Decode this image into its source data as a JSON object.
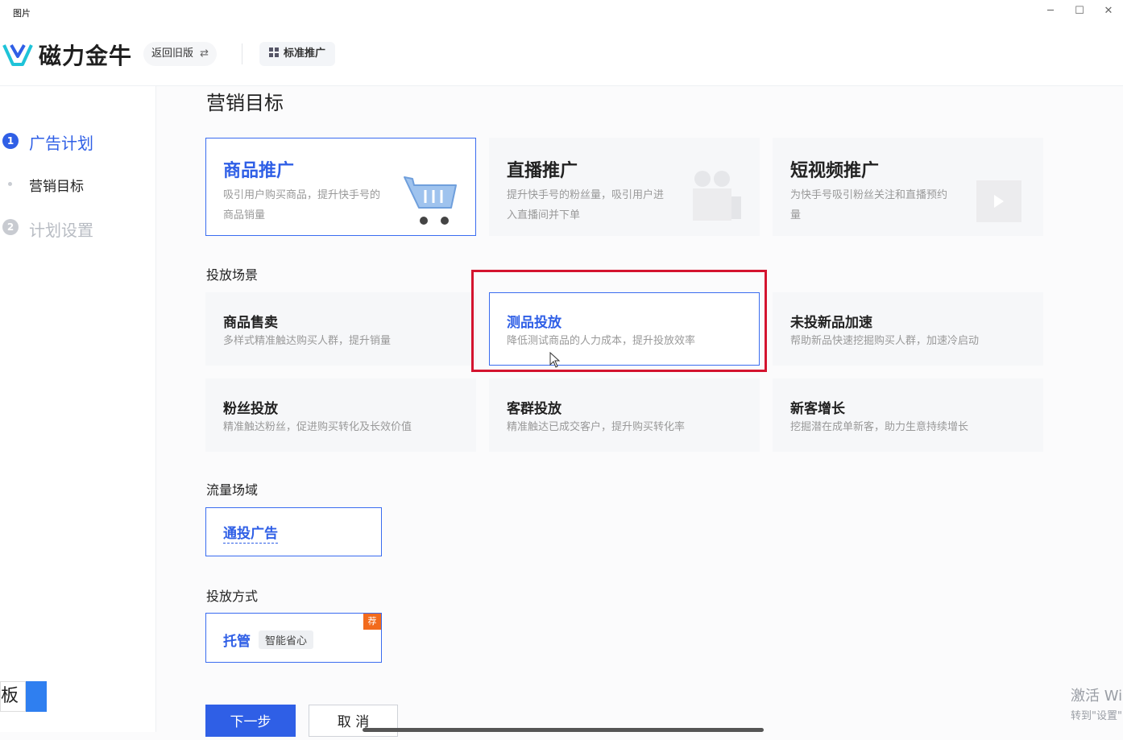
{
  "window": {
    "title": "图片"
  },
  "header": {
    "logo_text": "磁力金牛",
    "old_version": "返回旧版",
    "old_version_arrow": "⇄",
    "mode": "标准推广"
  },
  "sidebar": {
    "steps": [
      {
        "num": "1",
        "label": "广告计划"
      },
      {
        "label": "营销目标"
      },
      {
        "num": "2",
        "label": "计划设置"
      }
    ]
  },
  "page_title": "营销目标",
  "goals": [
    {
      "title": "商品推广",
      "desc": "吸引用户购买商品，提升快手号的商品销量"
    },
    {
      "title": "直播推广",
      "desc": "提升快手号的粉丝量，吸引用户进入直播间并下单"
    },
    {
      "title": "短视频推广",
      "desc": "为快手号吸引粉丝关注和直播预约量"
    }
  ],
  "sections": {
    "scene": "投放场景",
    "traffic": "流量场域",
    "method": "投放方式"
  },
  "scenes": [
    {
      "title": "商品售卖",
      "desc": "多样式精准触达购买人群，提升销量"
    },
    {
      "title": "测品投放",
      "desc": "降低测试商品的人力成本，提升投放效率"
    },
    {
      "title": "未投新品加速",
      "desc": "帮助新品快速挖掘购买人群，加速冷启动"
    },
    {
      "title": "粉丝投放",
      "desc": "精准触达粉丝，促进购买转化及长效价值"
    },
    {
      "title": "客群投放",
      "desc": "精准触达已成交客户，提升购买转化率"
    },
    {
      "title": "新客增长",
      "desc": "挖掘潜在成单新客，助力生意持续增长"
    }
  ],
  "traffic": {
    "title": "通投广告"
  },
  "method": {
    "title": "托管",
    "tag": "智能省心",
    "badge": "荐"
  },
  "buttons": {
    "next": "下一步",
    "cancel": "取 消"
  },
  "left_edge_label": "板",
  "watermark": {
    "line1": "激活 Wi",
    "line2": "转到\"设置\""
  },
  "colors": {
    "primary": "#2f5fe6",
    "highlight": "#d4142f",
    "badge": "#f26b1d"
  }
}
